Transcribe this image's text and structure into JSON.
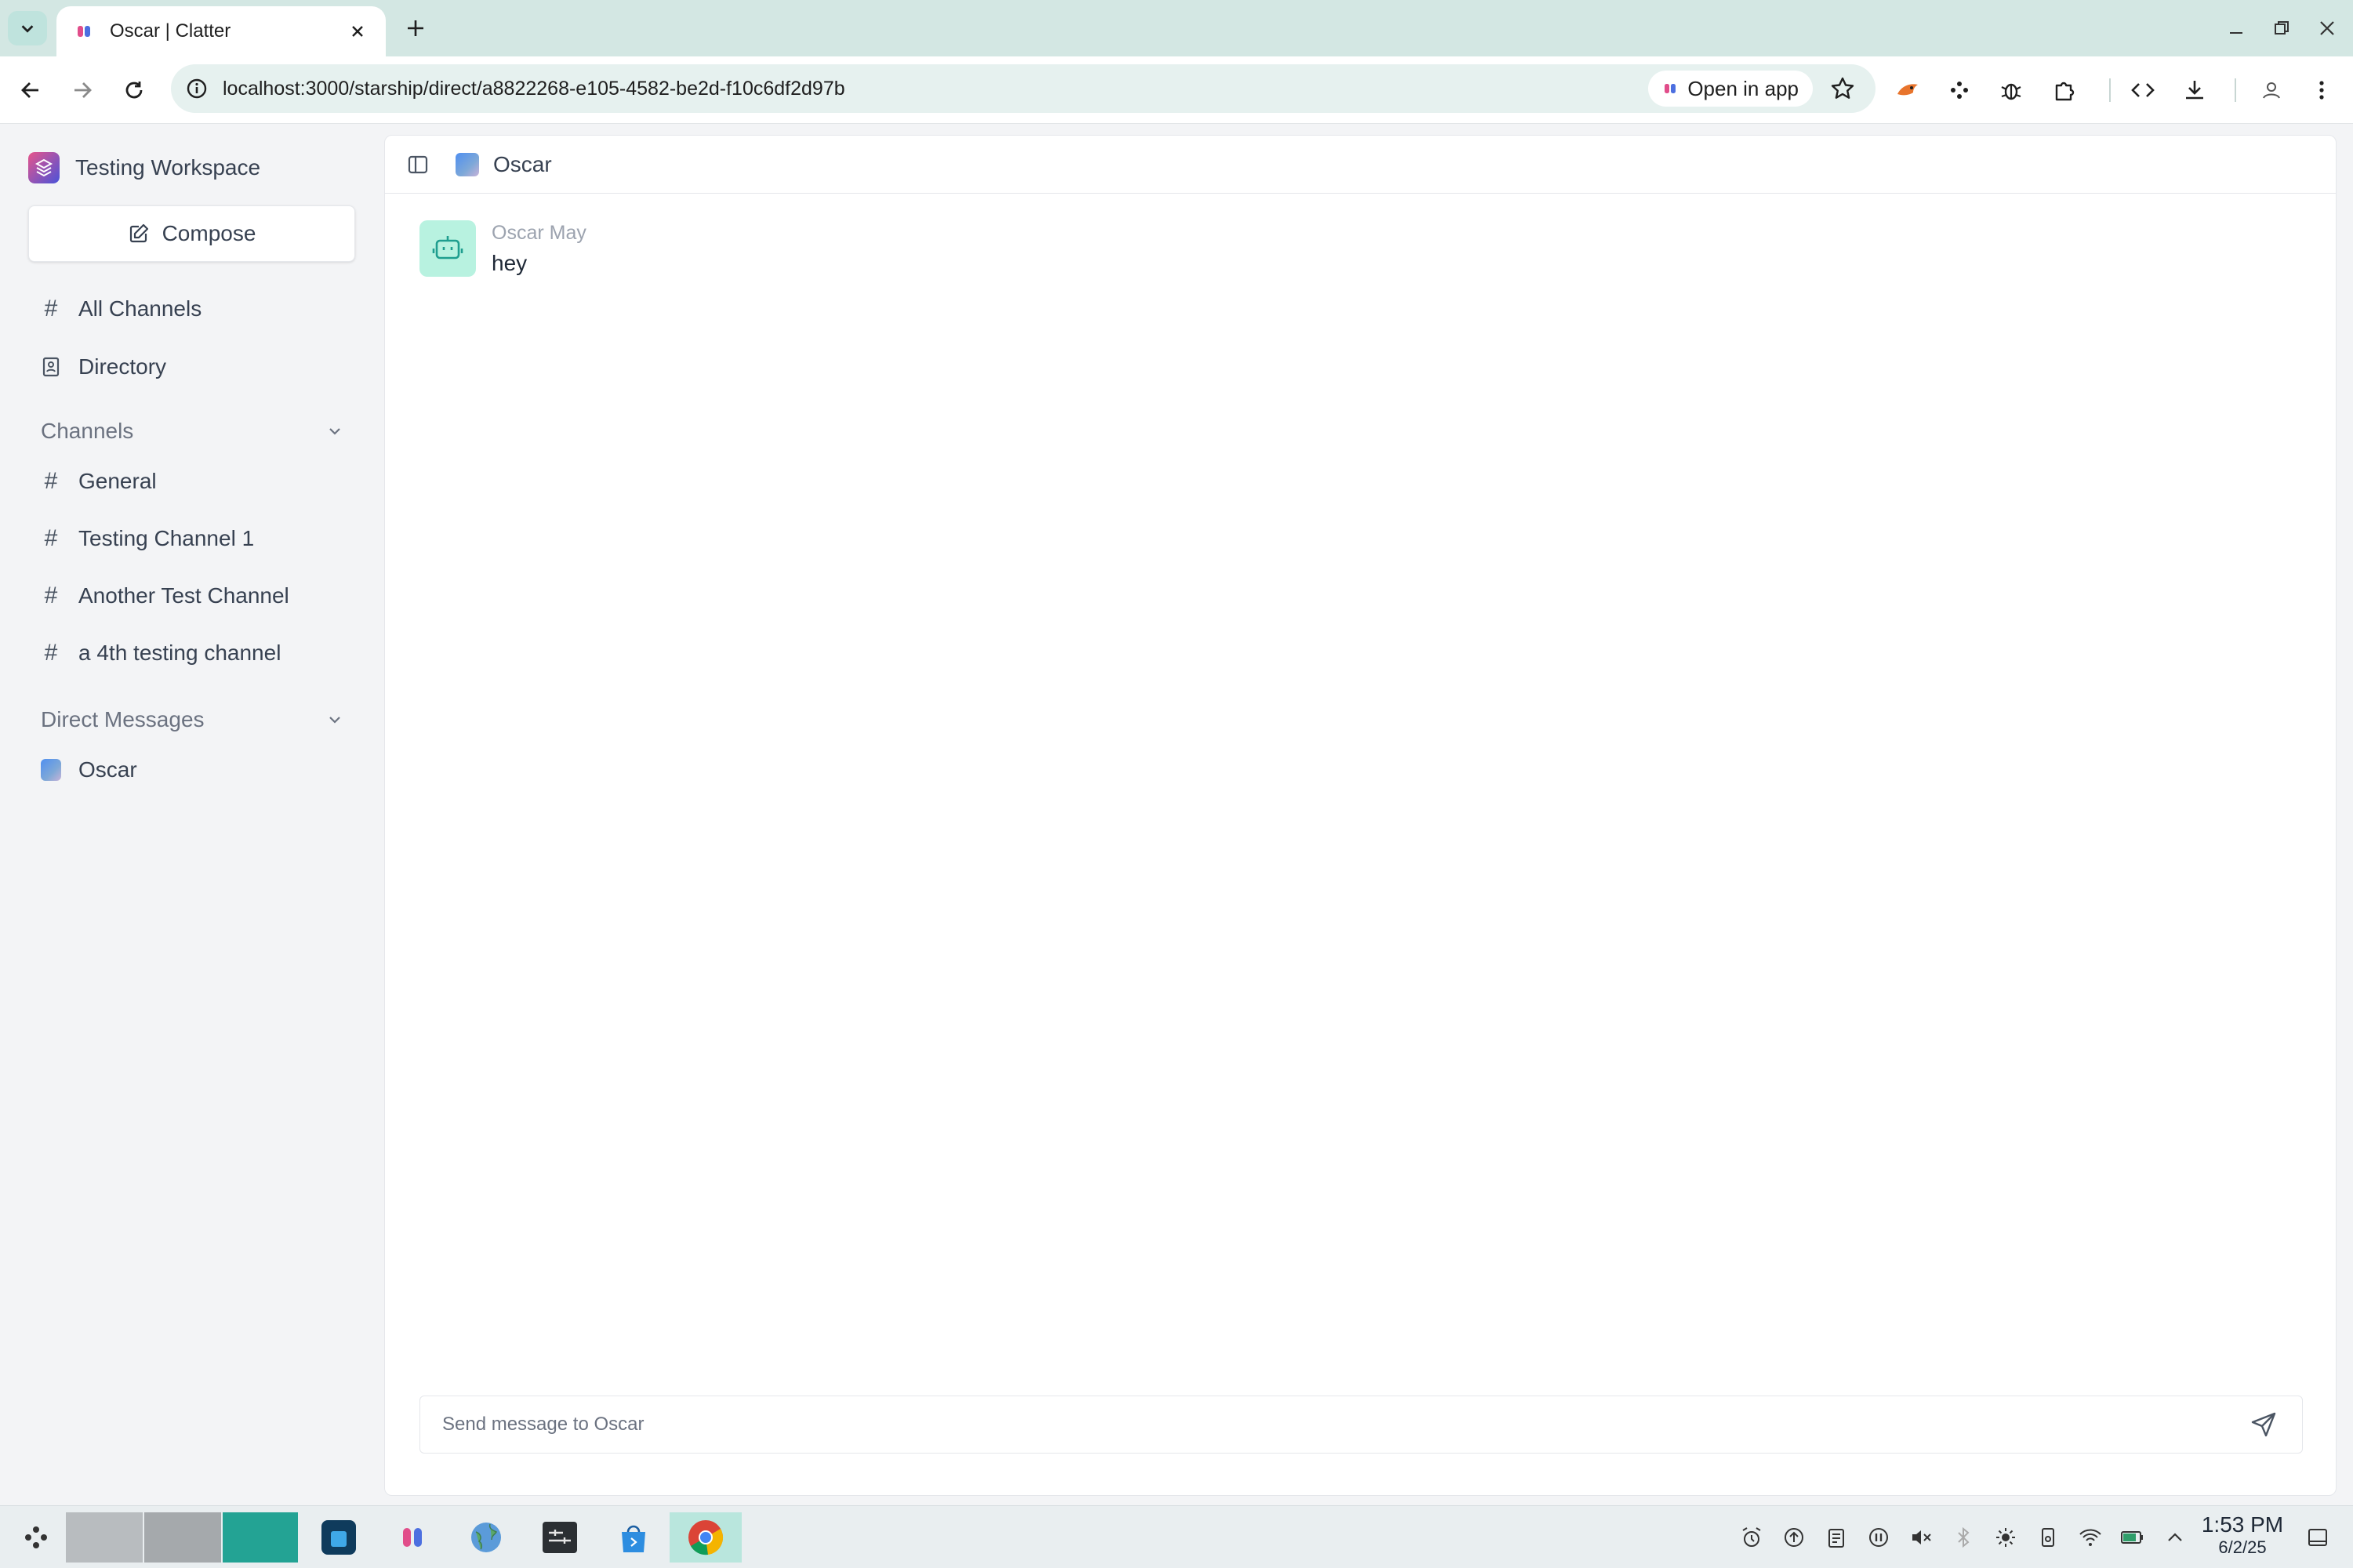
{
  "browser": {
    "tab_title": "Oscar | Clatter",
    "url": "localhost:3000/starship/direct/a8822268-e105-4582-be2d-f10c6df2d97b",
    "open_in_app_label": "Open in app"
  },
  "workspace": {
    "name": "Testing Workspace",
    "compose_label": "Compose"
  },
  "sidebar": {
    "top_items": [
      {
        "icon": "hash-icon",
        "label": "All Channels"
      },
      {
        "icon": "directory-icon",
        "label": "Directory"
      }
    ],
    "channels_header": "Channels",
    "channels": [
      {
        "label": "General"
      },
      {
        "label": "Testing Channel 1"
      },
      {
        "label": "Another Test Channel"
      },
      {
        "label": "a 4th testing channel"
      }
    ],
    "dm_header": "Direct Messages",
    "dms": [
      {
        "label": "Oscar"
      }
    ]
  },
  "conversation": {
    "title": "Oscar",
    "messages": [
      {
        "author": "Oscar May",
        "text": "hey",
        "avatar_icon": "bot-icon"
      }
    ],
    "composer_placeholder": "Send message to Oscar"
  },
  "taskbar": {
    "time": "1:53 PM",
    "date": "6/2/25"
  },
  "colors": {
    "tabstrip_bg": "#d3e7e3",
    "sidebar_bg": "#f3f4f6",
    "bot_avatar_bg": "#b8f2e0",
    "accent_teal": "#1f9e8f"
  }
}
